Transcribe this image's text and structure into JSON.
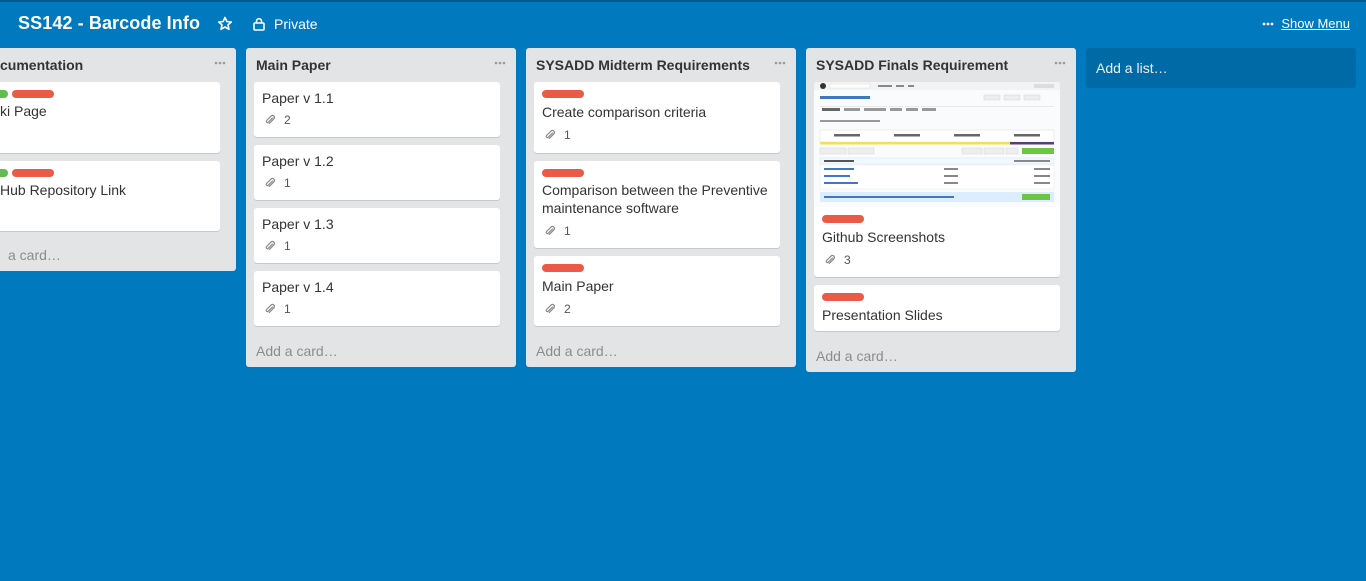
{
  "board": {
    "title": "SS142 - Barcode Info",
    "privacy": "Private",
    "show_menu": "Show Menu",
    "add_list": "Add a list…"
  },
  "colors": {
    "background": "#0079bf",
    "label_green": "#61bd4f",
    "label_red": "#eb5a46",
    "list_bg": "#e2e4e6"
  },
  "lists": [
    {
      "title": "Documentation",
      "visible_title": "cumentation",
      "cards": [
        {
          "title": "Wiki Page",
          "visible_title": "ki Page",
          "labels": [
            "green",
            "red"
          ]
        },
        {
          "title": "GitHub Repository Link",
          "visible_title": "Hub Repository Link",
          "labels": [
            "green",
            "red"
          ]
        }
      ],
      "add_card": "Add a card…",
      "visible_add_card": "a card…"
    },
    {
      "title": "Main Paper",
      "cards": [
        {
          "title": "Paper v 1.1",
          "attachments": "2"
        },
        {
          "title": "Paper v 1.2",
          "attachments": "1"
        },
        {
          "title": "Paper v 1.3",
          "attachments": "1"
        },
        {
          "title": "Paper v 1.4",
          "attachments": "1"
        }
      ],
      "add_card": "Add a card…"
    },
    {
      "title": "SYSADD Midterm Requirements",
      "cards": [
        {
          "title": "Create comparison criteria",
          "attachments": "1",
          "labels": [
            "red"
          ]
        },
        {
          "title": "Comparison between the Preventive maintenance software",
          "attachments": "1",
          "labels": [
            "red"
          ]
        },
        {
          "title": "Main Paper",
          "attachments": "2",
          "labels": [
            "red"
          ]
        }
      ],
      "add_card": "Add a card…"
    },
    {
      "title": "SYSADD Finals Requirement",
      "cards": [
        {
          "title": "Github Screenshots",
          "attachments": "3",
          "labels": [
            "red"
          ],
          "cover": "github-screenshot"
        },
        {
          "title": "Presentation Slides",
          "labels": [
            "red"
          ]
        }
      ],
      "add_card": "Add a card…"
    }
  ],
  "icons": {
    "star": "star-icon",
    "lock": "lock-icon",
    "menu": "ellipsis-icon",
    "attachment": "paperclip-icon"
  }
}
